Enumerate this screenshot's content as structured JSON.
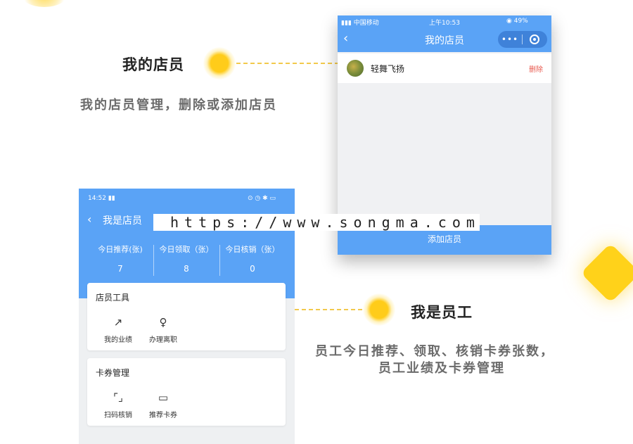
{
  "section_owner": {
    "title": "我的店员",
    "description": "我的店员管理，删除或添加店员"
  },
  "section_staff": {
    "title": "我是员工",
    "description_line1": "员工今日推荐、领取、核销卡券张数，",
    "description_line2": "员工业绩及卡券管理"
  },
  "phone1": {
    "status": {
      "carrier": "中国移动",
      "time": "上午10:53",
      "battery": "49%"
    },
    "nav": {
      "back_icon": "chevron-left-icon",
      "title": "我的店员",
      "more_label": "•••"
    },
    "staff": [
      {
        "name": "轻舞飞扬",
        "delete_label": "删除"
      }
    ],
    "add_button": "添加店员"
  },
  "phone2": {
    "status": {
      "time": "14:52"
    },
    "nav": {
      "title": "我是店员"
    },
    "stats": [
      {
        "label": "今日推荐(张)",
        "value": "7"
      },
      {
        "label": "今日领取（张）",
        "value": "8"
      },
      {
        "label": "今日核销（张）",
        "value": "0"
      }
    ],
    "tools_card": {
      "title": "店员工具",
      "items": [
        {
          "label": "我的业绩",
          "icon": "trend-chart-icon"
        },
        {
          "label": "办理离职",
          "icon": "user-icon"
        }
      ]
    },
    "coupon_card": {
      "title": "卡券管理",
      "items": [
        {
          "label": "扫码核销",
          "icon": "scan-icon"
        },
        {
          "label": "推荐卡券",
          "icon": "ticket-icon"
        }
      ]
    }
  },
  "watermark": "https://www.songma.com",
  "colors": {
    "brand_blue": "#5aa3f6",
    "accent_yellow": "#ffcc1a",
    "delete_red": "#e85a4f"
  }
}
